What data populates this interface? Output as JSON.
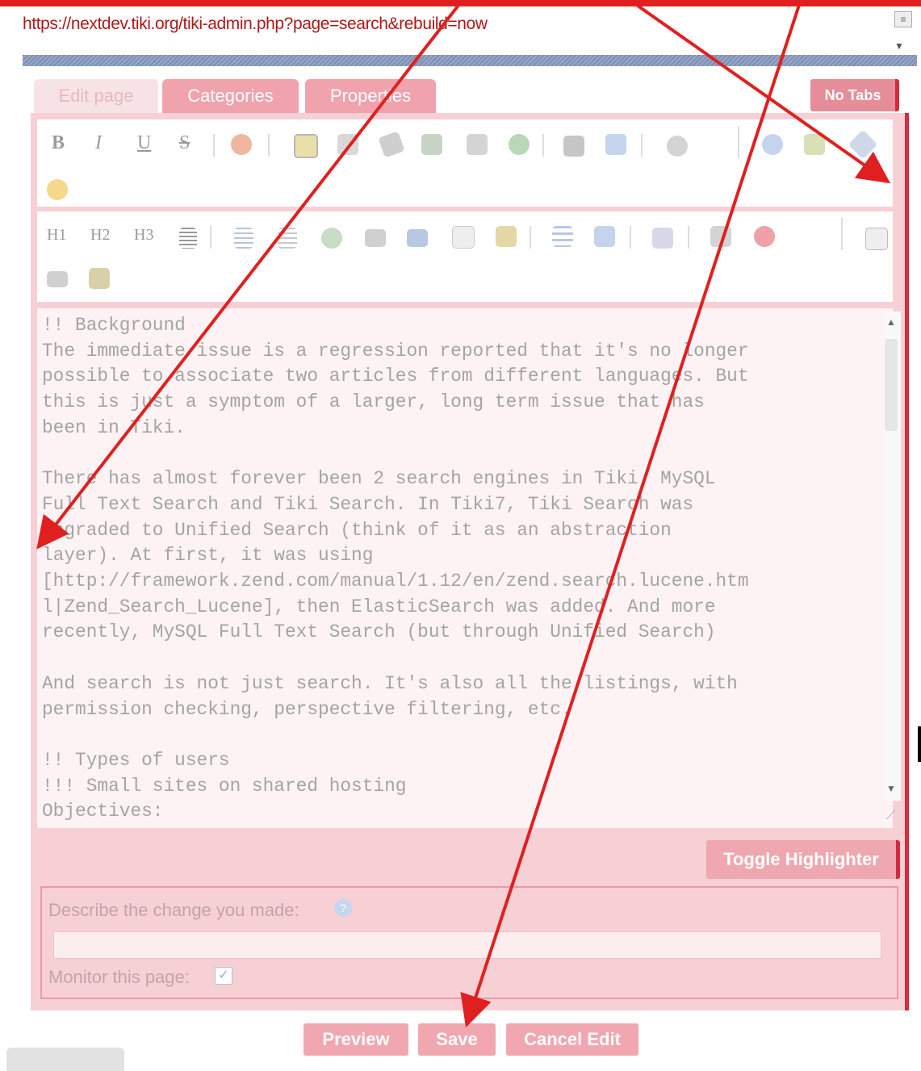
{
  "url": "https://nextdev.tiki.org/tiki-admin.php?page=search&rebuild=now",
  "tabs": [
    {
      "label": "Edit page"
    },
    {
      "label": "Categories"
    },
    {
      "label": "Properties"
    }
  ],
  "no_tabs_label": "No Tabs",
  "toolbar": {
    "bold": "B",
    "italic": "I",
    "underline": "U",
    "strike": "S",
    "h1": "H1",
    "h2": "H2",
    "h3": "H3"
  },
  "editor_text": "!! Background\nThe immediate issue is a regression reported that it's no longer\npossible to associate two articles from different languages. But\nthis is just a symptom of a larger, long term issue that has\nbeen in Tiki.\n\nThere has almost forever been 2 search engines in Tiki. MySQL\nFull Text Search and Tiki Search. In Tiki7, Tiki Search was\nupgraded to Unified Search (think of it as an abstraction\nlayer). At first, it was using\n[http://framework.zend.com/manual/1.12/en/zend.search.lucene.htm\nl|Zend_Search_Lucene], then ElasticSearch was added. And more\nrecently, MySQL Full Text Search (but through Unified Search)\n\nAnd search is not just search. It's also all the listings, with\npermission checking, perspective filtering, etc.\n\n!! Types of users\n!!! Small sites on shared hosting\nObjectives:",
  "toggle_highlighter_label": "Toggle Highlighter",
  "describe_label": "Describe the change you made:",
  "describe_value": "",
  "monitor_label": "Monitor this page:",
  "monitor_checked": true,
  "buttons": {
    "preview": "Preview",
    "save": "Save",
    "cancel": "Cancel Edit"
  },
  "colors": {
    "annotation_red": "#e02020",
    "panel_pink": "#f6d0d5",
    "button_pink": "#f1a7b0"
  }
}
